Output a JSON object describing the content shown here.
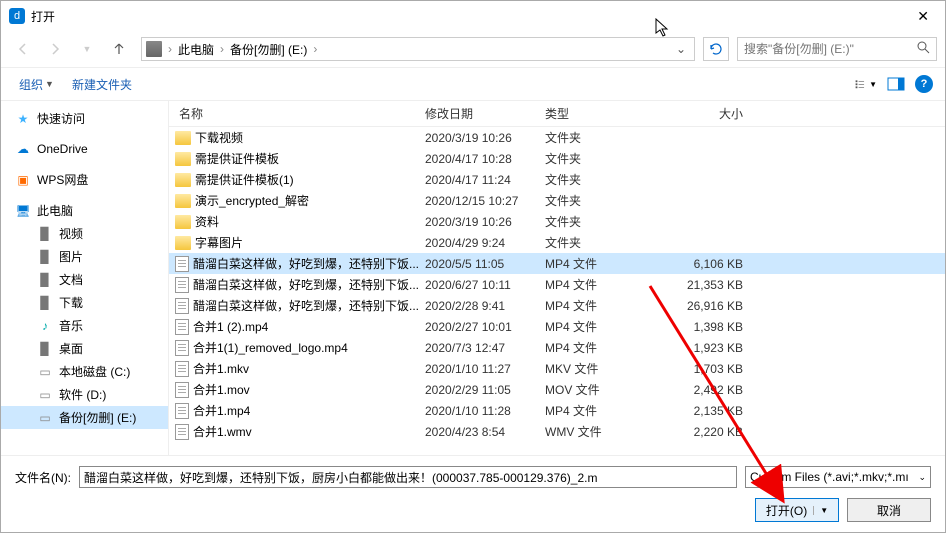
{
  "window": {
    "title": "打开"
  },
  "breadcrumb": {
    "items": [
      "此电脑",
      "备份[勿删] (E:)"
    ]
  },
  "search": {
    "placeholder": "搜索\"备份[勿删] (E:)\""
  },
  "toolbar": {
    "organize": "组织",
    "new_folder": "新建文件夹"
  },
  "sidebar": {
    "items": [
      {
        "label": "快速访问",
        "icon": "star",
        "indent": false
      },
      {
        "label": "OneDrive",
        "icon": "cloud",
        "indent": false
      },
      {
        "label": "WPS网盘",
        "icon": "box",
        "indent": false
      },
      {
        "label": "此电脑",
        "icon": "pc",
        "indent": false
      },
      {
        "label": "视频",
        "icon": "folder",
        "indent": true
      },
      {
        "label": "图片",
        "icon": "folder",
        "indent": true
      },
      {
        "label": "文档",
        "icon": "folder",
        "indent": true
      },
      {
        "label": "下载",
        "icon": "folder",
        "indent": true
      },
      {
        "label": "音乐",
        "icon": "music",
        "indent": true
      },
      {
        "label": "桌面",
        "icon": "folder",
        "indent": true
      },
      {
        "label": "本地磁盘 (C:)",
        "icon": "disk",
        "indent": true
      },
      {
        "label": "软件 (D:)",
        "icon": "disk",
        "indent": true
      },
      {
        "label": "备份[勿删] (E:)",
        "icon": "disk",
        "indent": true,
        "selected": true
      }
    ]
  },
  "columns": {
    "name": "名称",
    "date": "修改日期",
    "type": "类型",
    "size": "大小"
  },
  "files": [
    {
      "name": "下载视频",
      "date": "2020/3/19 10:26",
      "type": "文件夹",
      "size": "",
      "folder": true
    },
    {
      "name": "需提供证件模板",
      "date": "2020/4/17 10:28",
      "type": "文件夹",
      "size": "",
      "folder": true
    },
    {
      "name": "需提供证件模板(1)",
      "date": "2020/4/17 11:24",
      "type": "文件夹",
      "size": "",
      "folder": true
    },
    {
      "name": "演示_encrypted_解密",
      "date": "2020/12/15 10:27",
      "type": "文件夹",
      "size": "",
      "folder": true
    },
    {
      "name": "资料",
      "date": "2020/3/19 10:26",
      "type": "文件夹",
      "size": "",
      "folder": true
    },
    {
      "name": "字幕图片",
      "date": "2020/4/29 9:24",
      "type": "文件夹",
      "size": "",
      "folder": true
    },
    {
      "name": "醋溜白菜这样做，好吃到爆，还特别下饭...",
      "date": "2020/5/5 11:05",
      "type": "MP4 文件",
      "size": "6,106 KB",
      "folder": false,
      "selected": true
    },
    {
      "name": "醋溜白菜这样做，好吃到爆，还特别下饭...",
      "date": "2020/6/27 10:11",
      "type": "MP4 文件",
      "size": "21,353 KB",
      "folder": false
    },
    {
      "name": "醋溜白菜这样做，好吃到爆，还特别下饭...",
      "date": "2020/2/28 9:41",
      "type": "MP4 文件",
      "size": "26,916 KB",
      "folder": false
    },
    {
      "name": "合并1 (2).mp4",
      "date": "2020/2/27 10:01",
      "type": "MP4 文件",
      "size": "1,398 KB",
      "folder": false
    },
    {
      "name": "合并1(1)_removed_logo.mp4",
      "date": "2020/7/3 12:47",
      "type": "MP4 文件",
      "size": "1,923 KB",
      "folder": false
    },
    {
      "name": "合并1.mkv",
      "date": "2020/1/10 11:27",
      "type": "MKV 文件",
      "size": "1,703 KB",
      "folder": false
    },
    {
      "name": "合并1.mov",
      "date": "2020/2/29 11:05",
      "type": "MOV 文件",
      "size": "2,492 KB",
      "folder": false
    },
    {
      "name": "合并1.mp4",
      "date": "2020/1/10 11:28",
      "type": "MP4 文件",
      "size": "2,135 KB",
      "folder": false
    },
    {
      "name": "合并1.wmv",
      "date": "2020/4/23 8:54",
      "type": "WMV 文件",
      "size": "2,220 KB",
      "folder": false
    }
  ],
  "footer": {
    "filename_label": "文件名(N):",
    "filename_value": "醋溜白菜这样做，好吃到爆，还特别下饭，厨房小白都能做出来！(000037.785-000129.376)_2.m",
    "filter": "Custom Files (*.avi;*.mkv;*.mı",
    "open": "打开(O)",
    "cancel": "取消"
  }
}
